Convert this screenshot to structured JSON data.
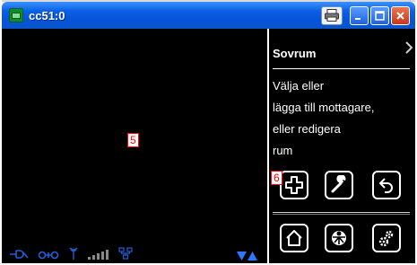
{
  "window": {
    "title": "cc51:0"
  },
  "overlay_badges": {
    "video_marker": "5",
    "add_marker": "6"
  },
  "panel": {
    "title": "Sovrum",
    "lines": [
      "Välja eller",
      "lägga till mottagare,",
      "eller redigera",
      "rum"
    ]
  },
  "icons": {
    "app": "screen-icon",
    "print": "printer-icon",
    "minimize": "minimize-icon",
    "maximize": "maximize-icon",
    "close": "close-icon",
    "expand": "chevron-right-icon",
    "add": "plus-icon",
    "edit": "wrench-icon",
    "back": "back-arrow-icon",
    "home": "home-icon",
    "media": "dome-icon",
    "settings": "gears-icon"
  },
  "colors": {
    "titlebar": "#0653d8",
    "background": "#000000",
    "status_icons": "#1f5fd8",
    "marker_border": "#ff0000"
  }
}
